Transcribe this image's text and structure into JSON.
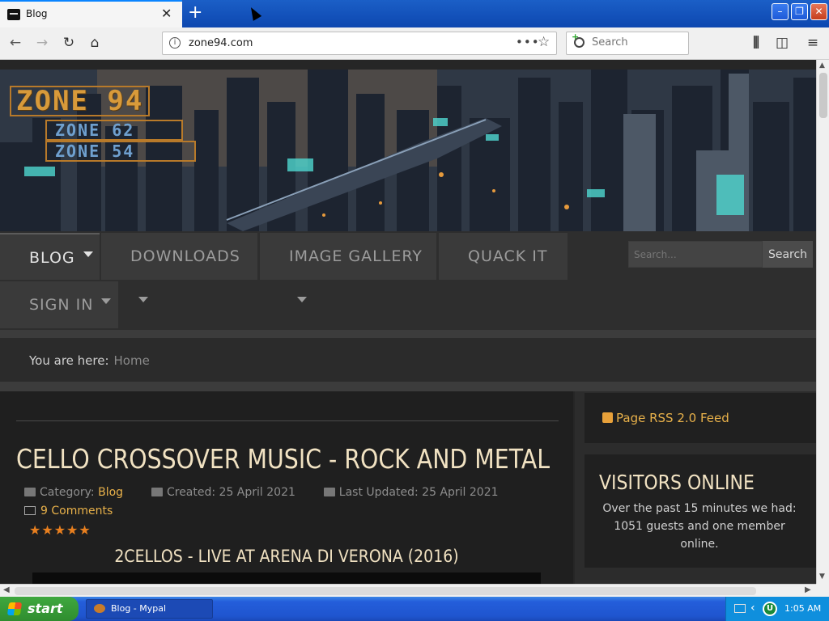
{
  "browser": {
    "tab_title": "Blog",
    "tab_close": "✕",
    "new_tab": "+",
    "url": "zone94.com",
    "url_more": "•••",
    "search_placeholder": "Search",
    "window_min": "–",
    "window_max": "❐",
    "window_close": "✕"
  },
  "site": {
    "logo_main": "ZONE 94",
    "logo_sub1": "ZONE 62",
    "logo_sub2": "ZONE 54",
    "menu": {
      "blog": "BLOG",
      "downloads": "DOWNLOADS",
      "gallery": "IMAGE GALLERY",
      "quack": "QUACK IT",
      "signin": "SIGN IN"
    },
    "search_placeholder": "Search...",
    "search_button": "Search",
    "breadcrumb_label": "You are here:",
    "breadcrumb_home": "Home"
  },
  "article": {
    "title": "CELLO CROSSOVER MUSIC - ROCK AND METAL",
    "category_label": "Category:",
    "category": "Blog",
    "created": "Created: 25 April 2021",
    "updated": "Last Updated: 25 April 2021",
    "comments": "9 Comments",
    "rating_stars": "★★★★★",
    "rating": 5,
    "video_title": "2CELLOS - LIVE AT ARENA DI VERONA (2016)"
  },
  "sidebar": {
    "rss": "Page RSS 2.0 Feed",
    "visitors_title": "VISITORS ONLINE",
    "visitors_text": "Over the past 15 minutes we had: 1051 guests and one member online."
  },
  "taskbar": {
    "start": "start",
    "task": "Blog - Mypal",
    "time": "1:05 AM"
  },
  "colors": {
    "accent": "#e8b14a",
    "title": "#f1e2c2",
    "star": "#e87f1f"
  }
}
